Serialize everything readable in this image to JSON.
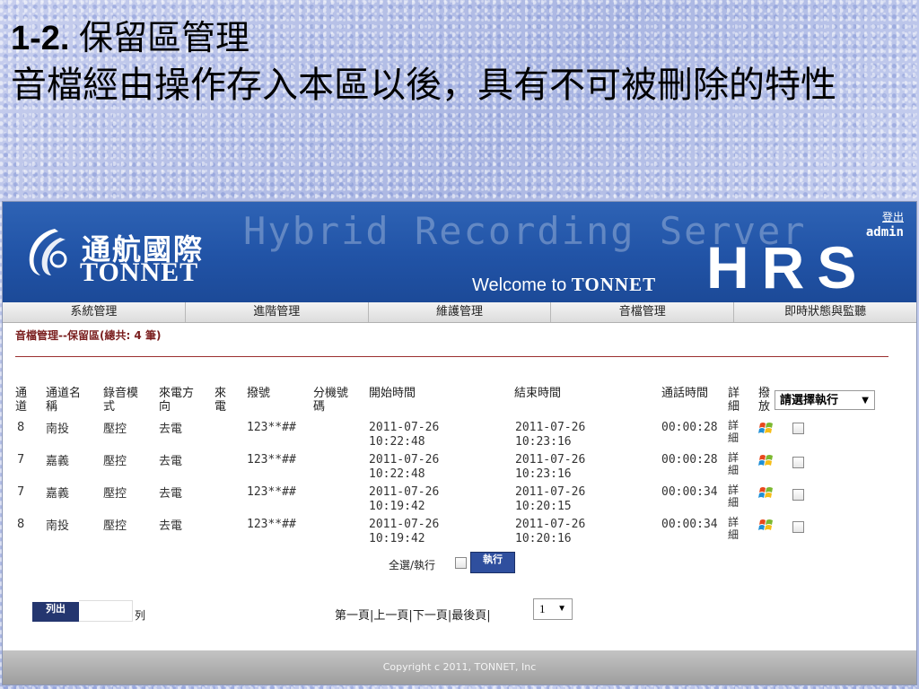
{
  "slide": {
    "heading_num": "1-2.",
    "heading_text": "保留區管理",
    "body": "音檔經由操作存入本區以後，具有不可被刪除的特性"
  },
  "header": {
    "logo_zh": "通航國際",
    "logo_en": "TONNET",
    "bg_text": "Hybrid Recording Server",
    "welcome_prefix": "Welcome to",
    "welcome_brand": "TONNET",
    "product": "HRS",
    "logout": "登出",
    "user": "admin"
  },
  "menu": [
    "系統管理",
    "進階管理",
    "維護管理",
    "音檔管理",
    "即時狀態與監聽"
  ],
  "page": {
    "section_title": "音檔管理--保留區(總共: 4 筆)"
  },
  "table": {
    "headers": {
      "channel": "通道",
      "channel_name": "通道名稱",
      "mode": "錄音模式",
      "direction": "來電方向",
      "caller": "來電",
      "dialed": "撥號",
      "ext": "分機號碼",
      "start": "開始時間",
      "end": "結束時間",
      "duration": "通話時間",
      "detail": "詳細",
      "play": "撥放"
    },
    "action_select": "請選擇執行",
    "rows": [
      {
        "channel": "8",
        "name": "南投",
        "mode": "壓控",
        "direction": "去電",
        "caller": "",
        "dialed": "123**##",
        "ext": "",
        "start_date": "2011-07-26",
        "start_time": "10:22:48",
        "end_date": "2011-07-26",
        "end_time": "10:23:16",
        "duration": "00:00:28",
        "detail": "詳細"
      },
      {
        "channel": "7",
        "name": "嘉義",
        "mode": "壓控",
        "direction": "去電",
        "caller": "",
        "dialed": "123**##",
        "ext": "",
        "start_date": "2011-07-26",
        "start_time": "10:22:48",
        "end_date": "2011-07-26",
        "end_time": "10:23:16",
        "duration": "00:00:28",
        "detail": "詳細"
      },
      {
        "channel": "7",
        "name": "嘉義",
        "mode": "壓控",
        "direction": "去電",
        "caller": "",
        "dialed": "123**##",
        "ext": "",
        "start_date": "2011-07-26",
        "start_time": "10:19:42",
        "end_date": "2011-07-26",
        "end_time": "10:20:15",
        "duration": "00:00:34",
        "detail": "詳細"
      },
      {
        "channel": "8",
        "name": "南投",
        "mode": "壓控",
        "direction": "去電",
        "caller": "",
        "dialed": "123**##",
        "ext": "",
        "start_date": "2011-07-26",
        "start_time": "10:19:42",
        "end_date": "2011-07-26",
        "end_time": "10:20:16",
        "duration": "00:00:34",
        "detail": "詳細"
      }
    ]
  },
  "bulk": {
    "select_all": "全選/執行",
    "execute": "執行"
  },
  "paging": {
    "list_button": "列出",
    "rows_value": "",
    "rows_label": "列",
    "first": "第一頁",
    "prev": "上一頁",
    "next": "下一頁",
    "last": "最後頁",
    "page": "1"
  },
  "footer": "Copyright c 2011, TONNET, Inc",
  "colors": {
    "banner": "#2356a8",
    "section_title": "#7a1f1f",
    "button": "#24366f"
  }
}
